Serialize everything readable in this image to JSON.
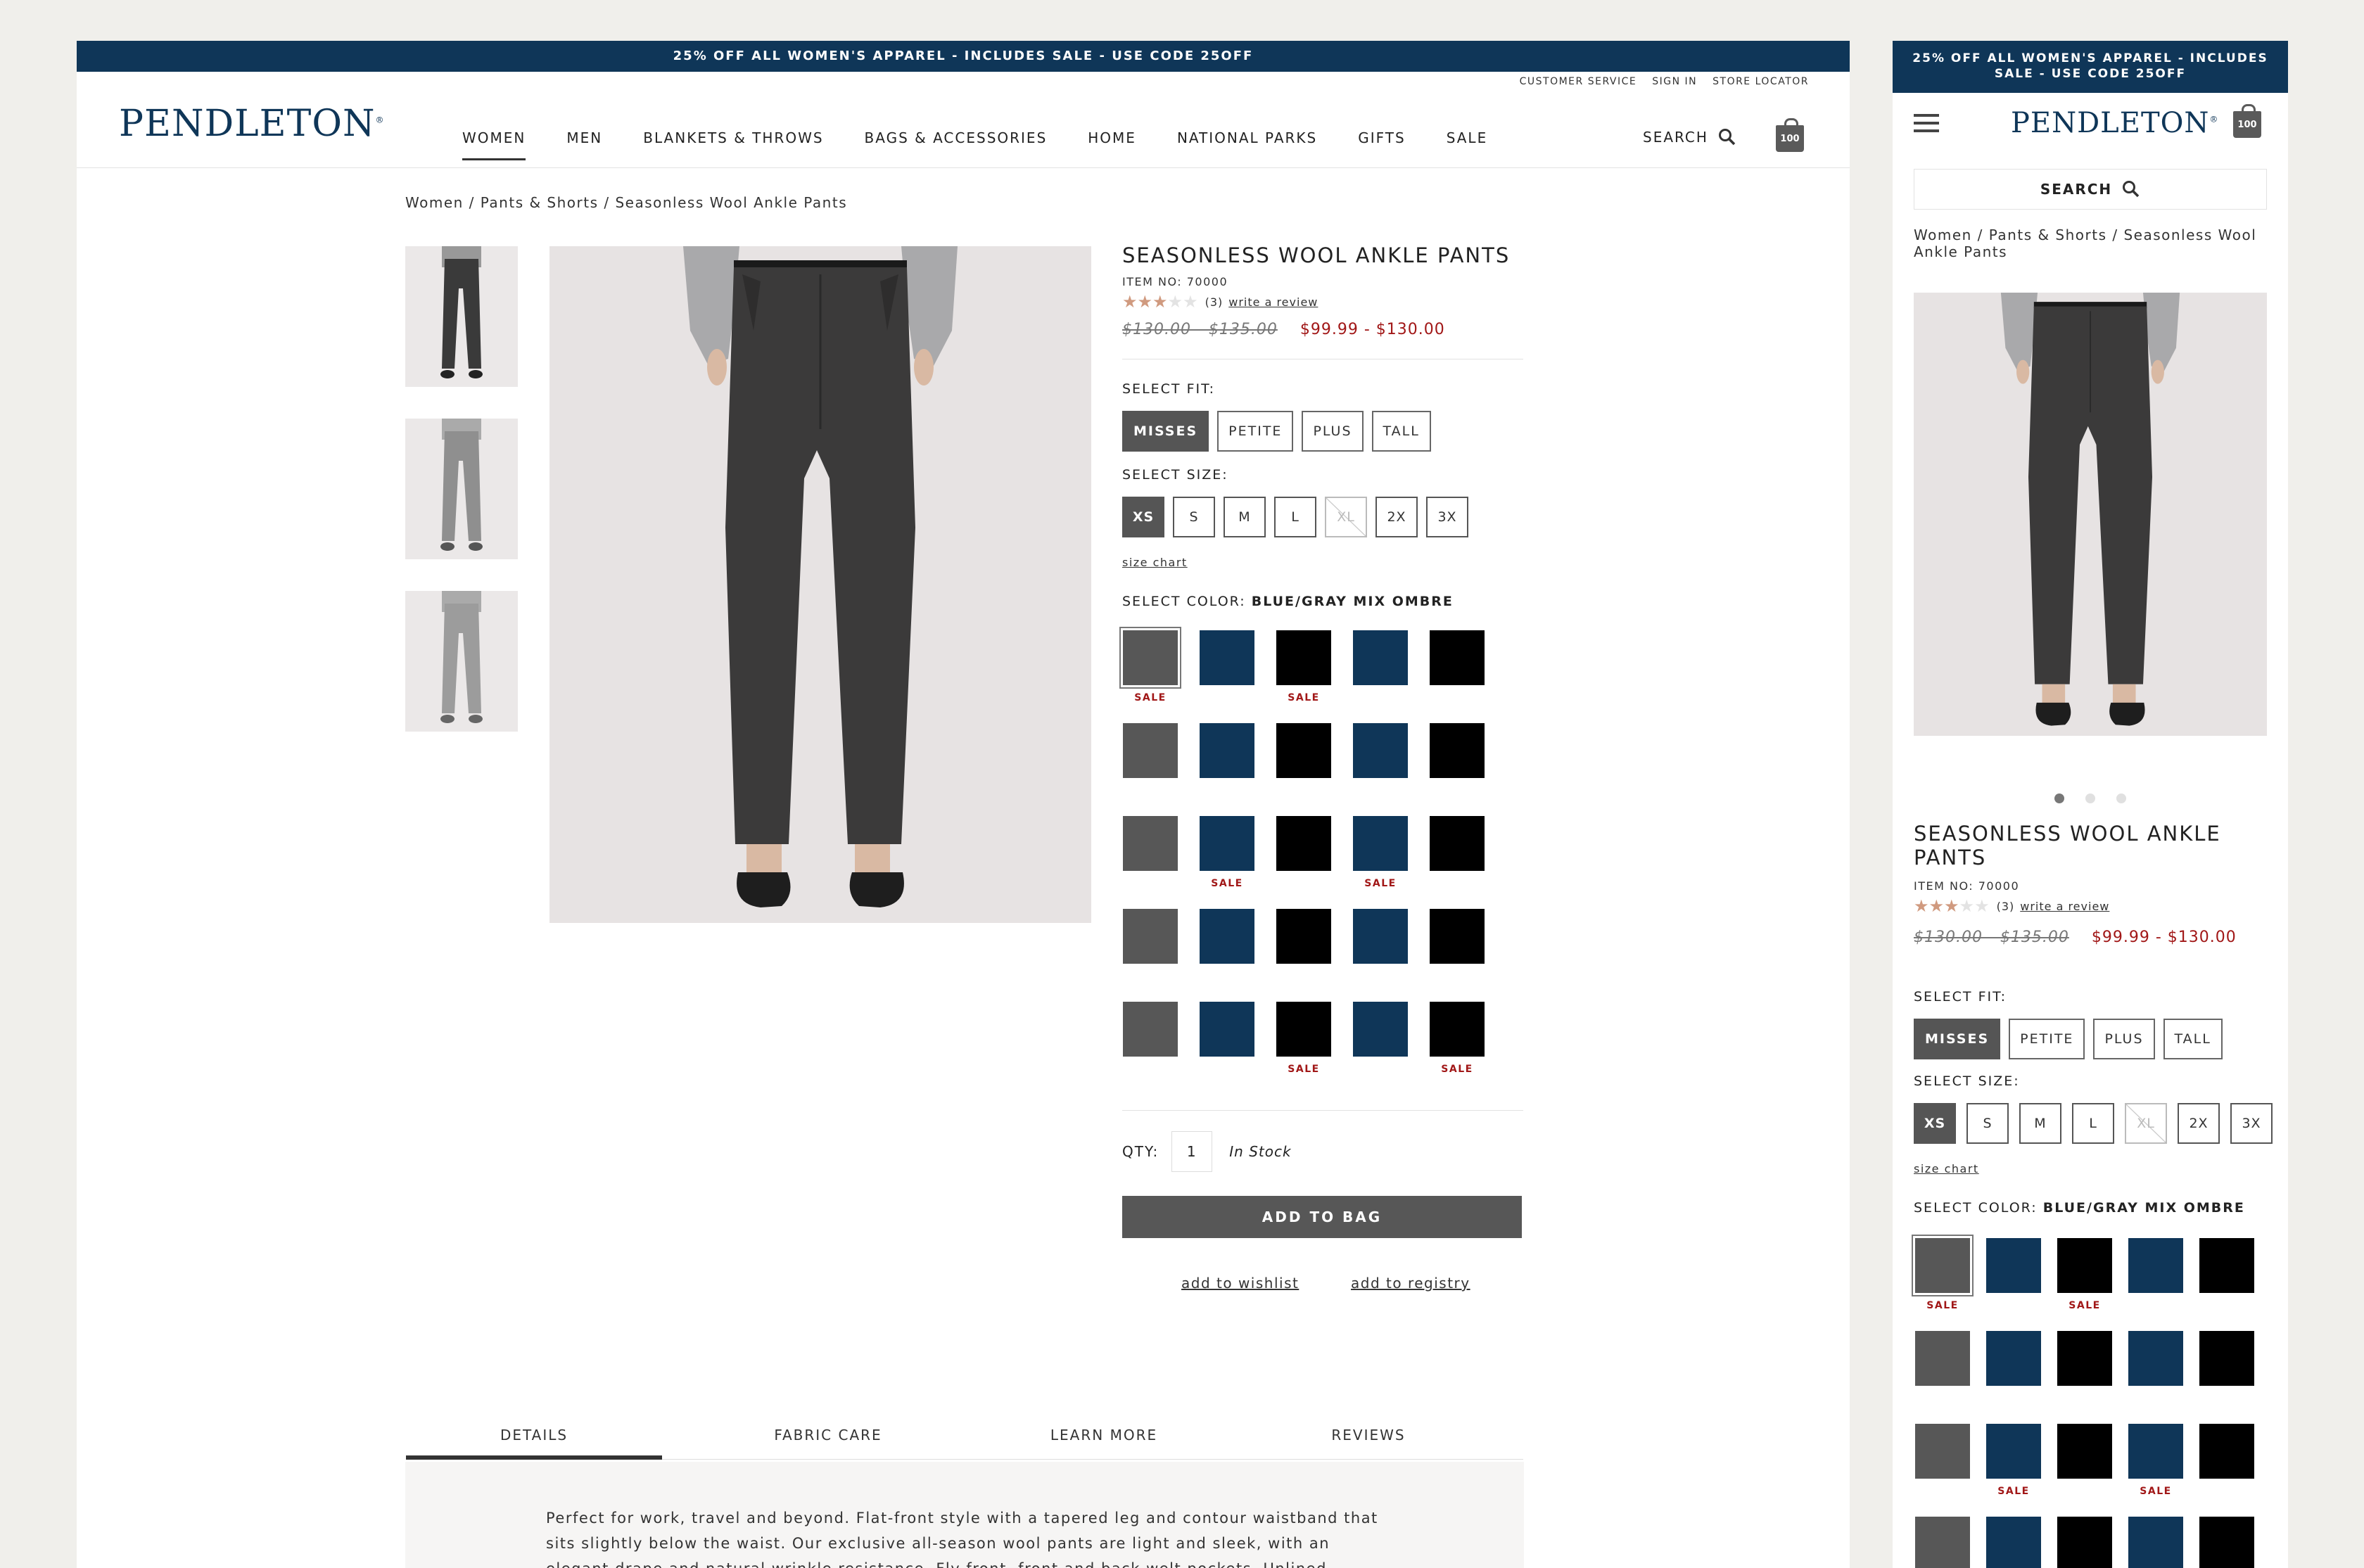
{
  "promo": {
    "text": "25% OFF ALL WOMEN'S APPAREL - INCLUDES SALE - USE CODE 25OFF"
  },
  "utility_nav": {
    "customer_service": "CUSTOMER SERVICE",
    "sign_in": "SIGN IN",
    "store_locator": "STORE LOCATOR"
  },
  "brand": {
    "logo": "PENDLETON",
    "trademark": "®"
  },
  "nav": {
    "women": "WOMEN",
    "men": "MEN",
    "blankets": "BLANKETS & THROWS",
    "bags": "BAGS & ACCESSORIES",
    "home": "HOME",
    "parks": "NATIONAL PARKS",
    "gifts": "GIFTS",
    "sale": "SALE"
  },
  "search": {
    "label": "SEARCH"
  },
  "bag": {
    "count": "100"
  },
  "breadcrumb": {
    "text": "Women / Pants & Shorts / Seasonless Wool Ankle Pants"
  },
  "product": {
    "title": "SEASONLESS WOOL ANKLE PANTS",
    "item_no": "ITEM NO: 70000",
    "rating": 3,
    "review_count": "(3)",
    "write_review": "write a review",
    "price_old": "$130.00 - $135.00",
    "price_new": "$99.99 - $130.00"
  },
  "fit": {
    "label": "SELECT FIT:",
    "misses": "MISSES",
    "petite": "PETITE",
    "plus": "PLUS",
    "tall": "TALL",
    "selected": "MISSES"
  },
  "size": {
    "label": "SELECT SIZE:",
    "xs": "XS",
    "s": "S",
    "m": "M",
    "l": "L",
    "xl": "XL",
    "x2": "2X",
    "x3": "3X",
    "selected": "XS",
    "unavailable": "XL"
  },
  "size_chart": "size chart",
  "color": {
    "label": "SELECT COLOR:",
    "value": "BLUE/GRAY MIX OMBRE",
    "sale_label": "SALE"
  },
  "swatch_colors": {
    "grey": "#575757",
    "navy": "#0f3658",
    "black": "#000000"
  },
  "qty": {
    "label": "QTY:",
    "value": "1",
    "stock": "In Stock"
  },
  "add_to_bag": "ADD TO BAG",
  "add_to_wishlist": "add to wishlist",
  "add_to_registry": "add to registry",
  "tabs": {
    "details": "DETAILS",
    "fabric_care": "FABRIC CARE",
    "learn_more": "LEARN MORE",
    "reviews": "REVIEWS"
  },
  "details_text": "Perfect for work, travel and beyond. Flat-front style with a tapered leg and contour waistband that sits slightly below the waist. Our exclusive all-season wool pants are light and sleek, with an elegant drape and natural wrinkle resistance. Fly front, front and back welt pockets. Unlined.",
  "colors": {
    "accent": "#0f3658",
    "sale": "#a11717",
    "button": "#575757"
  }
}
